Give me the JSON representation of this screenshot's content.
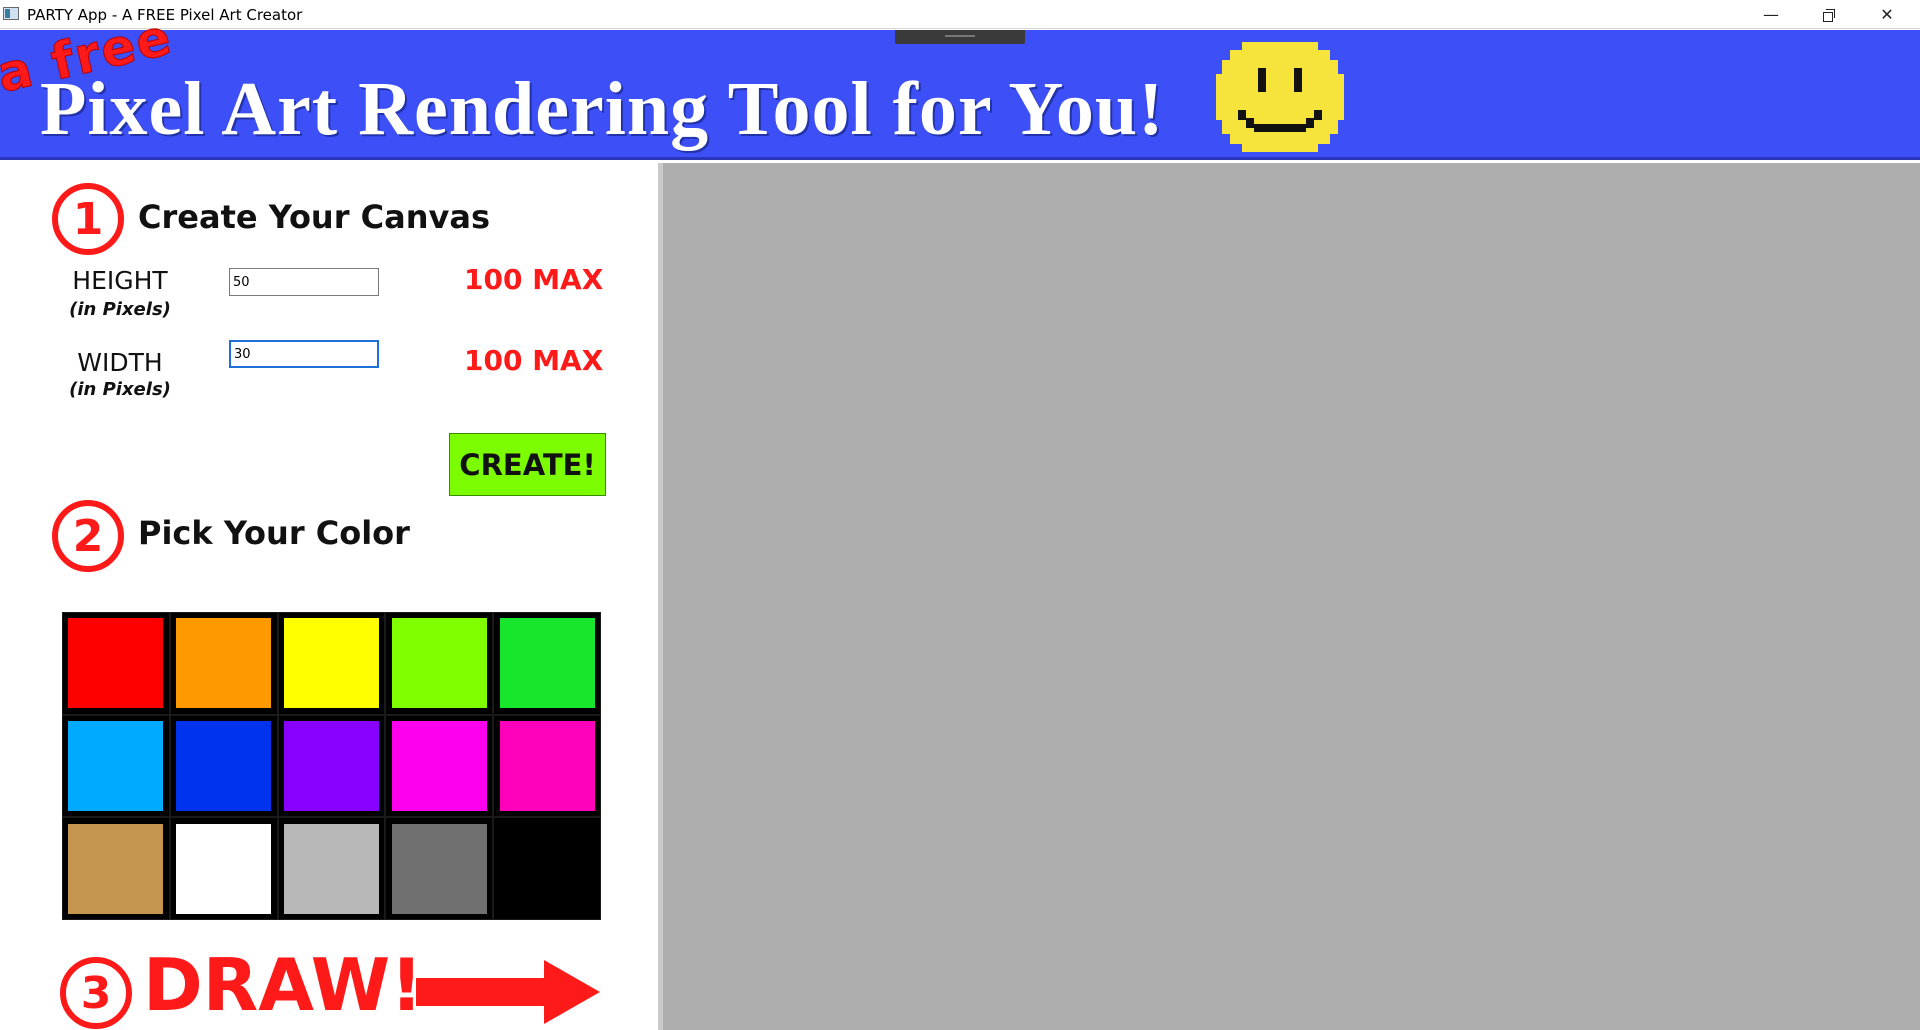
{
  "window": {
    "title": "PARTY App - A FREE Pixel Art Creator",
    "minimize": "—",
    "close": "✕"
  },
  "banner": {
    "tagline": "a free",
    "title": "Pixel Art Rendering Tool for You!",
    "smiley_icon": "smiley-face-icon",
    "background": "#3d4ff7"
  },
  "step1": {
    "number": "1",
    "title": "Create Your Canvas",
    "height_label": "HEIGHT",
    "height_sub": "(in Pixels)",
    "height_value": "50",
    "height_max": "100 MAX",
    "width_label": "WIDTH",
    "width_sub": "(in Pixels)",
    "width_value": "30",
    "width_max": "100 MAX",
    "create_label": "CREATE!"
  },
  "step2": {
    "number": "2",
    "title": "Pick Your Color",
    "palette": [
      "#ff0000",
      "#ff9900",
      "#ffff00",
      "#80ff00",
      "#17e62c",
      "#00aaff",
      "#0033ee",
      "#8800ff",
      "#ff00ee",
      "#ff00bb",
      "#c4954f",
      "#ffffff",
      "#b8b8b8",
      "#707070",
      "#000000"
    ]
  },
  "step3": {
    "number": "3",
    "label": "DRAW!"
  },
  "colors": {
    "accent_red": "#ff1a1a",
    "create_green": "#7cfc00",
    "canvas_gray": "#afaeaf"
  }
}
